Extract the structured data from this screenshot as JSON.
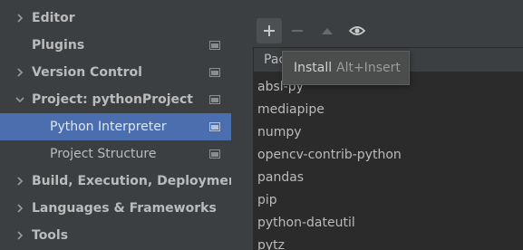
{
  "sidebar": {
    "items": [
      {
        "label": "Editor",
        "expandable": true,
        "expanded": false,
        "bold": true,
        "project_icon": false
      },
      {
        "label": "Plugins",
        "expandable": false,
        "bold": true,
        "project_icon": true
      },
      {
        "label": "Version Control",
        "expandable": true,
        "expanded": false,
        "bold": true,
        "project_icon": true
      },
      {
        "label": "Project: pythonProject",
        "expandable": true,
        "expanded": true,
        "bold": true,
        "project_icon": true
      },
      {
        "label": "Python Interpreter",
        "expandable": false,
        "bold": false,
        "selected": true,
        "project_icon": true
      },
      {
        "label": "Project Structure",
        "expandable": false,
        "bold": false,
        "project_icon": true
      },
      {
        "label": "Build, Execution, Deployment",
        "expandable": true,
        "expanded": false,
        "bold": true,
        "project_icon": false
      },
      {
        "label": "Languages & Frameworks",
        "expandable": true,
        "expanded": false,
        "bold": true,
        "project_icon": false
      },
      {
        "label": "Tools",
        "expandable": true,
        "expanded": false,
        "bold": true,
        "project_icon": false
      }
    ]
  },
  "toolbar": {
    "buttons": [
      {
        "name": "add",
        "icon": "plus-icon",
        "enabled": true
      },
      {
        "name": "remove",
        "icon": "minus-icon",
        "enabled": false
      },
      {
        "name": "upgrade",
        "icon": "triangle-up-icon",
        "enabled": false
      },
      {
        "name": "show-early-releases",
        "icon": "eye-icon",
        "enabled": true
      }
    ]
  },
  "table": {
    "header": "Pac",
    "packages": [
      "absl-py",
      "mediapipe",
      "numpy",
      "opencv-contrib-python",
      "pandas",
      "pip",
      "python-dateutil",
      "pytz"
    ]
  },
  "tooltip": {
    "label": "Install",
    "shortcut": "Alt+Insert"
  },
  "colors": {
    "background": "#3c3f41",
    "selection": "#4b6eaf",
    "list_background": "#2b2b2b",
    "text": "#bbbbbb"
  }
}
